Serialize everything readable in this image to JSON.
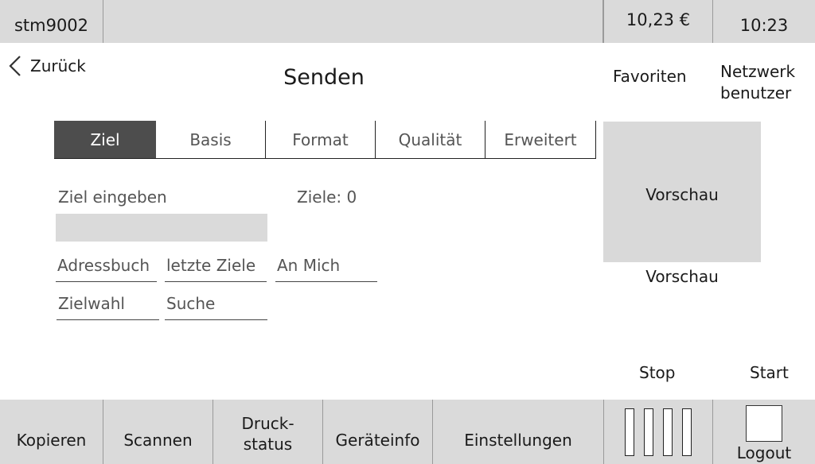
{
  "status": {
    "device": "stm9002",
    "balance": "10,23 €",
    "time": "10:23"
  },
  "header": {
    "back_label": "Zurück",
    "title": "Senden",
    "favorites": "Favoriten",
    "network_user_line1": "Netzwerk",
    "network_user_line2": "benutzer"
  },
  "tabs": [
    "Ziel",
    "Basis",
    "Format",
    "Qualität",
    "Erweitert"
  ],
  "active_tab": "Ziel",
  "content": {
    "enter_target_label": "Ziel eingeben",
    "target_input_value": "",
    "targets_count": "Ziele: 0",
    "buttons": [
      "Adressbuch",
      "letzte Ziele",
      "An Mich",
      "Zielwahl",
      "Suche"
    ]
  },
  "preview": {
    "box_label": "Vorschau",
    "caption": "Vorschau"
  },
  "actions": {
    "stop": "Stop",
    "start": "Start"
  },
  "bottom_nav": {
    "copy": "Kopieren",
    "scan": "Scannen",
    "print_status_line1": "Druck-",
    "print_status_line2": "status",
    "device_info": "Geräteinfo",
    "settings": "Einstellungen",
    "logout": "Logout"
  },
  "colors": {
    "bar_gray": "#dadada",
    "active_tab": "#4d4d4d",
    "preview_gray": "#d9d9d9"
  },
  "icons": [
    "chevron-left-icon",
    "bars-icon",
    "logout-icon"
  ]
}
